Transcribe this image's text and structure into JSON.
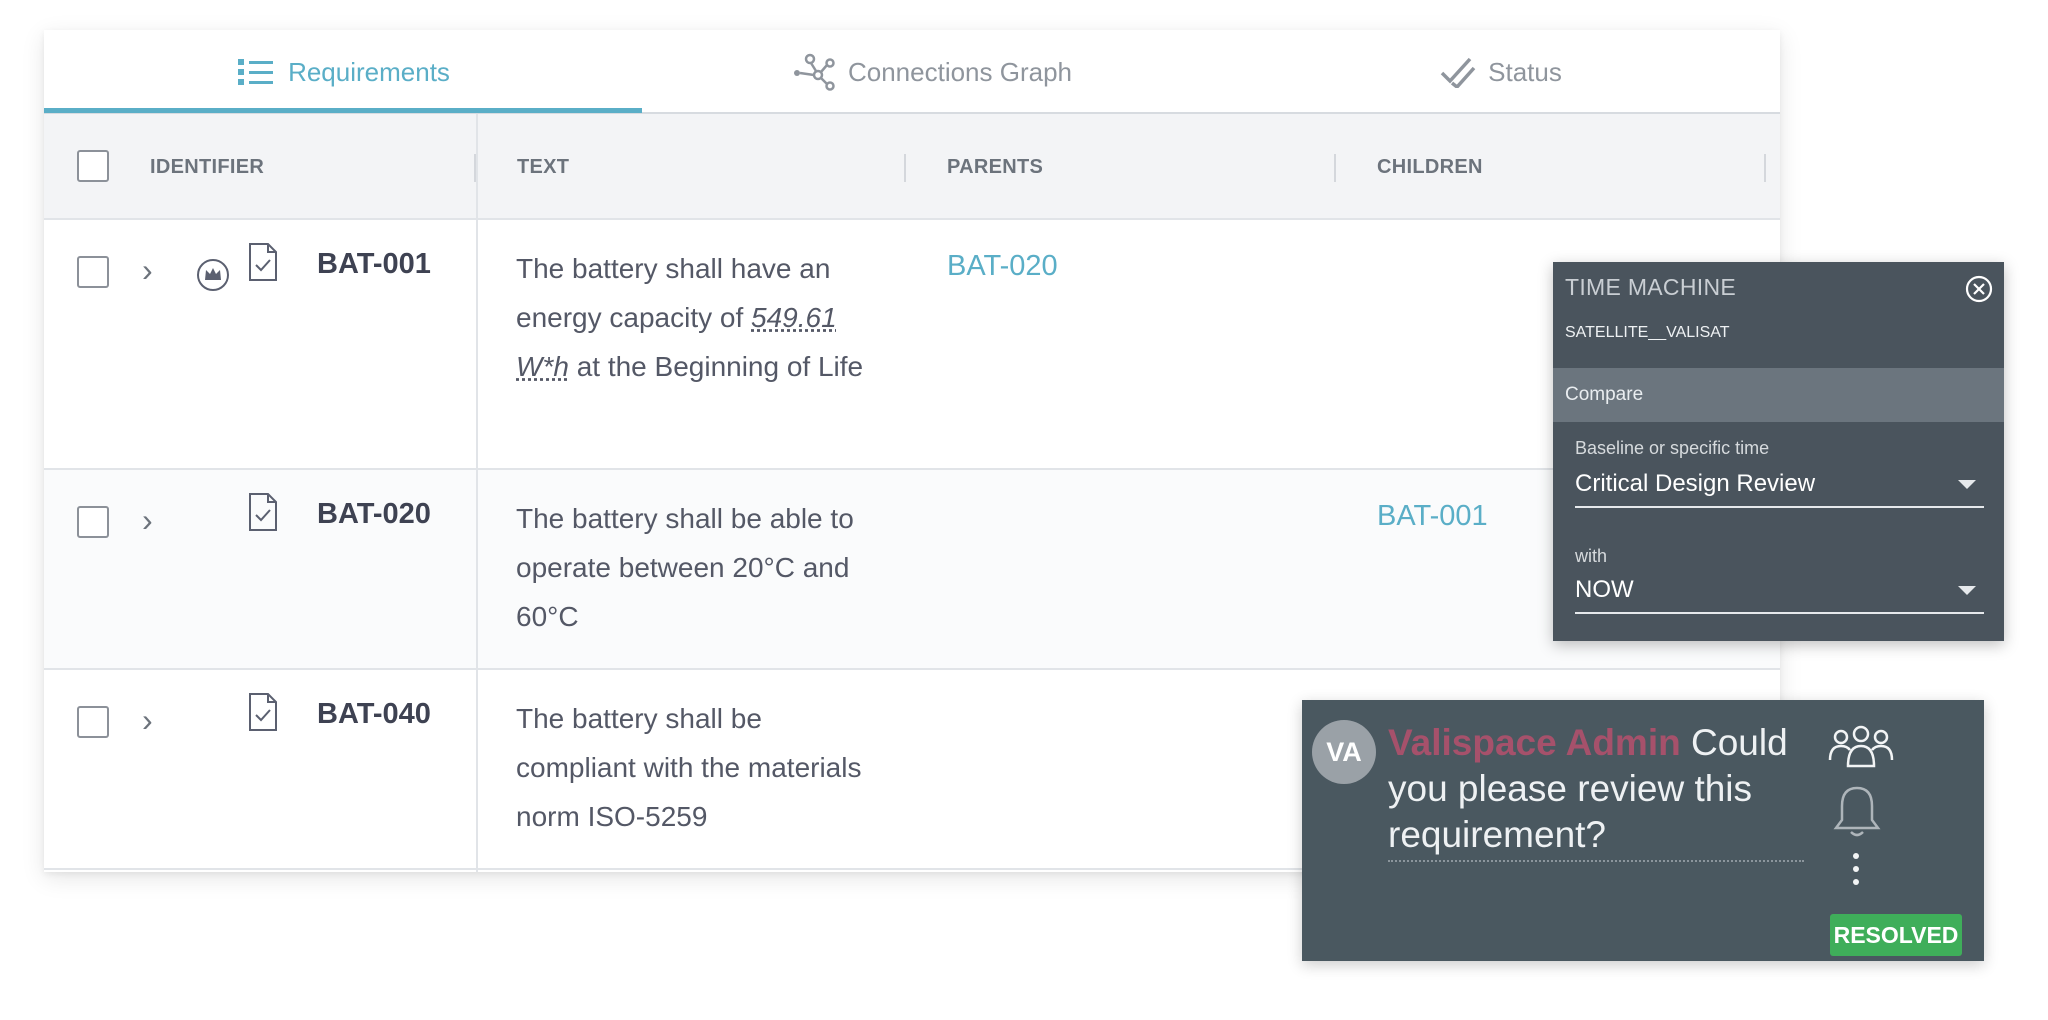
{
  "tabs": [
    {
      "label": "Requirements",
      "icon": "list-icon",
      "active": true
    },
    {
      "label": "Connections Graph",
      "icon": "graph-icon",
      "active": false
    },
    {
      "label": "Status",
      "icon": "double-check-icon",
      "active": false
    }
  ],
  "columns": {
    "identifier": "IDENTIFIER",
    "text": "TEXT",
    "parents": "PARENTS",
    "children": "CHILDREN"
  },
  "rows": [
    {
      "id": "BAT-001",
      "text_before": "The battery shall have an energy capacity of",
      "text_unit": "549.61 W*h",
      "text_after": "at the Beginning of Life",
      "parents": "BAT-020",
      "children": ""
    },
    {
      "id": "BAT-020",
      "text": "The battery shall be able to operate between 20°C and 60°C",
      "parents": "",
      "children": "BAT-001"
    },
    {
      "id": "BAT-040",
      "text": "The battery shall be compliant with the materials norm ISO-5259",
      "parents": "",
      "children": ""
    }
  ],
  "time_machine": {
    "title": "TIME MACHINE",
    "project": "SATELLITE__VALISAT",
    "compare_label": "Compare",
    "baseline_label": "Baseline or specific time",
    "baseline_value": "Critical Design Review",
    "with_label": "with",
    "with_value": "NOW"
  },
  "comment": {
    "avatar_initials": "VA",
    "author": "Valispace Admin",
    "message": "Could you please review this requirement?",
    "status": "RESOLVED"
  },
  "colors": {
    "accent": "#5aaec7",
    "author": "#a6516b",
    "resolved": "#3fae5a",
    "panel": "#4a545d"
  }
}
